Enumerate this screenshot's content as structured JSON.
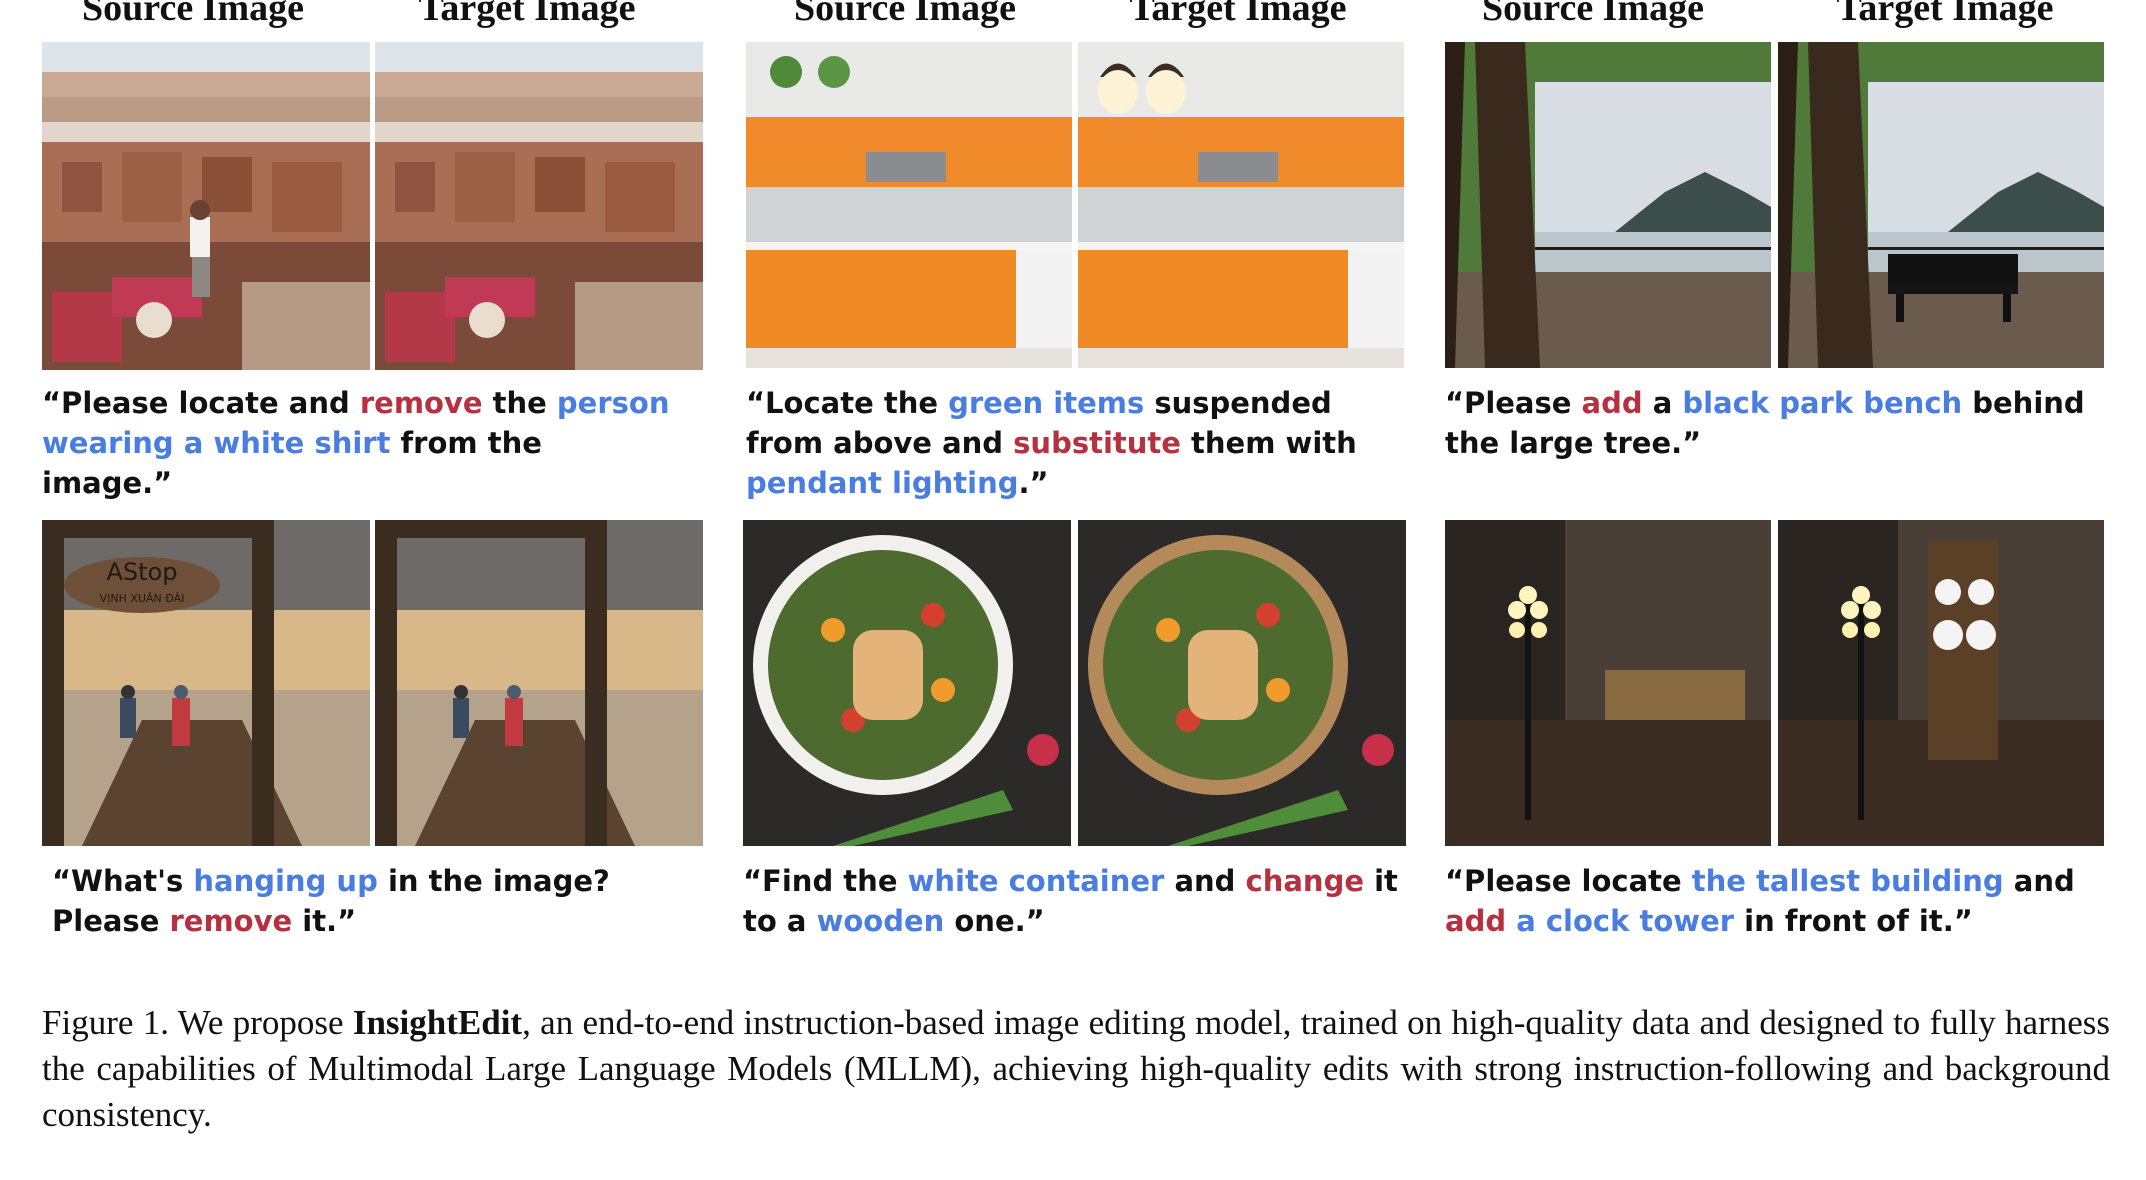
{
  "headers": {
    "source": "Source Image",
    "target": "Target Image"
  },
  "captions": {
    "c1": [
      {
        "t": "“Please locate and ",
        "c": ""
      },
      {
        "t": "remove",
        "c": "red"
      },
      {
        "t": " the ",
        "c": ""
      },
      {
        "t": "person wearing a white shirt",
        "c": "blue"
      },
      {
        "t": " from the image.”",
        "c": ""
      }
    ],
    "c2": [
      {
        "t": "“Locate the ",
        "c": ""
      },
      {
        "t": "green items",
        "c": "blue"
      },
      {
        "t": " suspended from above and ",
        "c": ""
      },
      {
        "t": "substitute",
        "c": "red"
      },
      {
        "t": " them with ",
        "c": ""
      },
      {
        "t": "pendant lighting",
        "c": "blue"
      },
      {
        "t": ".”",
        "c": ""
      }
    ],
    "c3": [
      {
        "t": "“Please ",
        "c": ""
      },
      {
        "t": "add",
        "c": "red"
      },
      {
        "t": " a ",
        "c": ""
      },
      {
        "t": "black park bench",
        "c": "blue"
      },
      {
        "t": " behind the large tree.”",
        "c": ""
      }
    ],
    "c4": [
      {
        "t": "“What's ",
        "c": ""
      },
      {
        "t": "hanging up",
        "c": "blue"
      },
      {
        "t": " in the image? Please ",
        "c": ""
      },
      {
        "t": "remove",
        "c": "red"
      },
      {
        "t": " it.”",
        "c": ""
      }
    ],
    "c5": [
      {
        "t": "“Find the ",
        "c": ""
      },
      {
        "t": "white container",
        "c": "blue"
      },
      {
        "t": " and ",
        "c": ""
      },
      {
        "t": "change",
        "c": "red"
      },
      {
        "t": " it to a ",
        "c": ""
      },
      {
        "t": "wooden",
        "c": "blue"
      },
      {
        "t": " one.”",
        "c": ""
      }
    ],
    "c6": [
      {
        "t": "“Please locate ",
        "c": ""
      },
      {
        "t": "the tallest building",
        "c": "blue"
      },
      {
        "t": " and ",
        "c": ""
      },
      {
        "t": "add",
        "c": "red"
      },
      {
        "t": " a ",
        "c": "blue"
      },
      {
        "t": "clock tower",
        "c": "blue"
      },
      {
        "t": " in front of it.”",
        "c": ""
      }
    ]
  },
  "sign_text": {
    "line1": "AStop",
    "line2": "VỊNH XUÂN ĐÀI"
  },
  "figure_caption": {
    "label": "Figure 1. We propose ",
    "model": "InsightEdit",
    "rest": ", an end-to-end instruction-based image editing model, trained on high-quality data and designed to fully harness the capabilities of Multimodal Large Language Models (MLLM), achieving high-quality edits with strong instruction-following and background consistency."
  },
  "colors": {
    "blue": "#4a7de0",
    "red": "#b5313f"
  }
}
